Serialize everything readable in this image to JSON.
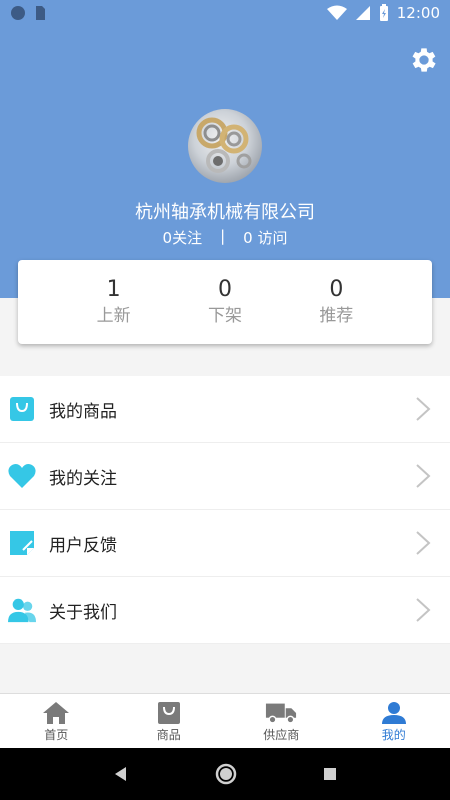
{
  "status_bar": {
    "time": "12:00"
  },
  "header": {
    "company_name": "杭州轴承机械有限公司",
    "follow_count": "0关注",
    "separator": "|",
    "visit_count": "0 访问"
  },
  "stats": [
    {
      "value": "1",
      "label": "上新"
    },
    {
      "value": "0",
      "label": "下架"
    },
    {
      "value": "0",
      "label": "推荐"
    }
  ],
  "menu": [
    {
      "label": "我的商品",
      "icon": "shopping-bag-icon"
    },
    {
      "label": "我的关注",
      "icon": "heart-icon"
    },
    {
      "label": "用户反馈",
      "icon": "feedback-note-icon"
    },
    {
      "label": "关于我们",
      "icon": "people-icon"
    }
  ],
  "tabs": [
    {
      "label": "首页",
      "icon": "home-icon"
    },
    {
      "label": "商品",
      "icon": "bag-icon"
    },
    {
      "label": "供应商",
      "icon": "truck-icon"
    },
    {
      "label": "我的",
      "icon": "user-icon",
      "active": true
    }
  ],
  "colors": {
    "header_bg": "#6b9bd9",
    "menu_icon": "#35c7e6",
    "tab_active": "#2f7bd4"
  }
}
